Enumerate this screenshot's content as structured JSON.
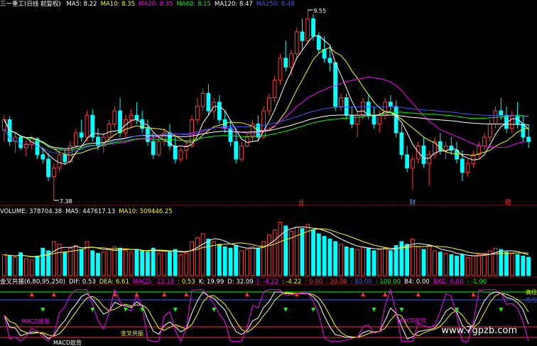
{
  "main_header": {
    "stock": "三一重工(日线 前复权)",
    "ma": [
      {
        "text": "MA5: 8.22",
        "color": "#ffffff"
      },
      {
        "text": "MA10: 8.35",
        "color": "#ffff00"
      },
      {
        "text": "MA20: 8.35",
        "color": "#ff00ff"
      },
      {
        "text": "MA60: 8.15",
        "color": "#00ff00"
      },
      {
        "text": "MA120: 8.47",
        "color": "#ffffff"
      },
      {
        "text": "MA250: 8.48",
        "color": "#3b5bff"
      }
    ]
  },
  "vol_header": {
    "items": [
      {
        "text": "VOLUME: 378704.38",
        "color": "#ffffff"
      },
      {
        "text": "MA5: 447617.13",
        "color": "#ffffff"
      },
      {
        "text": "MA10: 509446.25",
        "color": "#ffff00"
      }
    ]
  },
  "ind_header": {
    "items": [
      {
        "text": "金叉共振(6,80,95,250)",
        "color": "#ffffff"
      },
      {
        "text": "DIF: 0.53",
        "color": "#ffffff"
      },
      {
        "text": "DEA: 6.61",
        "color": "#ffff00"
      },
      {
        "text": "MACD: -12.18",
        "color": "#ff00ff"
      },
      {
        "text": ": 0.53",
        "color": "#ffff00"
      },
      {
        "text": "K: 19.99",
        "color": "#ffffff"
      },
      {
        "text": "D: 32.09",
        "color": "#ffffff"
      },
      {
        "text": "J: -4.22",
        "color": "#ff00ff"
      },
      {
        "text": ": -4.22",
        "color": "#ffff00"
      },
      {
        "text": ": 0.00",
        "color": "#ff3030"
      },
      {
        "text": ": 20.00",
        "color": "#ff3030"
      },
      {
        "text": ": 80.00",
        "color": "#3b5bff"
      },
      {
        "text": ": 100.00",
        "color": "#00ff00"
      },
      {
        "text": "B4: 0.00",
        "color": "#ffffff"
      },
      {
        "text": "BXG: 0.00",
        "color": "#ff00ff"
      },
      {
        "text": ": -1.00",
        "color": "#00ff00"
      }
    ]
  },
  "chart_data": [
    {
      "type": "candlestick",
      "name_label": "三一重工(日线 前复权)",
      "price_range": [
        7.38,
        9.55
      ],
      "high_label": "9.55",
      "low_label": "7.38",
      "events": [
        {
          "label": "业",
          "color": "#ff3030"
        },
        {
          "label": "财",
          "color": "#3b9bff"
        },
        {
          "label": "增",
          "color": "#ff3030"
        }
      ],
      "candles": [
        [
          8.18,
          8.35,
          8.05,
          8.3
        ],
        [
          8.3,
          8.34,
          8.0,
          8.05
        ],
        [
          8.05,
          8.15,
          7.92,
          8.1
        ],
        [
          8.1,
          8.12,
          7.95,
          7.98
        ],
        [
          7.98,
          8.06,
          7.88,
          8.02
        ],
        [
          8.02,
          8.12,
          7.96,
          8.08
        ],
        [
          8.08,
          8.1,
          7.85,
          7.9
        ],
        [
          7.9,
          7.98,
          7.8,
          7.85
        ],
        [
          7.85,
          7.92,
          7.6,
          7.65
        ],
        [
          7.65,
          7.8,
          7.38,
          7.75
        ],
        [
          7.75,
          7.95,
          7.7,
          7.9
        ],
        [
          7.9,
          7.96,
          7.78,
          7.82
        ],
        [
          7.82,
          8.05,
          7.8,
          8.0
        ],
        [
          8.0,
          8.2,
          7.98,
          8.15
        ],
        [
          8.15,
          8.3,
          8.05,
          8.1
        ],
        [
          8.1,
          8.4,
          8.05,
          8.35
        ],
        [
          8.35,
          8.42,
          8.05,
          8.1
        ],
        [
          8.1,
          8.2,
          7.95,
          8.0
        ],
        [
          8.0,
          8.15,
          7.92,
          8.1
        ],
        [
          8.1,
          8.3,
          8.05,
          8.25
        ],
        [
          8.25,
          8.45,
          8.2,
          8.4
        ],
        [
          8.4,
          8.55,
          8.1,
          8.15
        ],
        [
          8.15,
          8.35,
          8.1,
          8.3
        ],
        [
          8.3,
          8.42,
          8.2,
          8.35
        ],
        [
          8.35,
          8.5,
          8.25,
          8.3
        ],
        [
          8.3,
          8.4,
          8.15,
          8.2
        ],
        [
          8.2,
          8.3,
          8.0,
          8.05
        ],
        [
          8.05,
          8.15,
          7.85,
          7.9
        ],
        [
          7.9,
          8.1,
          7.88,
          8.05
        ],
        [
          8.05,
          8.2,
          8.0,
          8.15
        ],
        [
          8.15,
          8.25,
          7.95,
          8.0
        ],
        [
          8.0,
          8.1,
          7.8,
          7.85
        ],
        [
          7.85,
          7.98,
          7.82,
          7.95
        ],
        [
          7.95,
          8.05,
          7.85,
          8.0
        ],
        [
          8.0,
          8.35,
          7.98,
          8.3
        ],
        [
          8.3,
          8.55,
          8.25,
          8.45
        ],
        [
          8.45,
          8.65,
          8.4,
          8.6
        ],
        [
          8.6,
          8.7,
          8.35,
          8.4
        ],
        [
          8.4,
          8.55,
          8.3,
          8.5
        ],
        [
          8.5,
          8.58,
          8.25,
          8.3
        ],
        [
          8.3,
          8.4,
          8.15,
          8.2
        ],
        [
          8.2,
          8.3,
          8.0,
          8.05
        ],
        [
          8.05,
          8.2,
          7.8,
          7.85
        ],
        [
          7.85,
          8.05,
          7.82,
          8.0
        ],
        [
          8.0,
          8.15,
          7.98,
          8.1
        ],
        [
          8.1,
          8.3,
          8.05,
          8.25
        ],
        [
          8.25,
          8.35,
          8.05,
          8.1
        ],
        [
          8.1,
          8.45,
          8.08,
          8.4
        ],
        [
          8.4,
          8.6,
          8.35,
          8.55
        ],
        [
          8.55,
          8.8,
          8.5,
          8.75
        ],
        [
          8.75,
          9.05,
          8.7,
          9.0
        ],
        [
          9.0,
          9.2,
          8.85,
          8.9
        ],
        [
          8.9,
          9.1,
          8.8,
          9.05
        ],
        [
          9.05,
          9.35,
          9.0,
          9.3
        ],
        [
          9.3,
          9.45,
          9.1,
          9.2
        ],
        [
          9.2,
          9.55,
          9.15,
          9.45
        ],
        [
          9.45,
          9.5,
          9.2,
          9.25
        ],
        [
          9.25,
          9.3,
          9.05,
          9.1
        ],
        [
          9.1,
          9.25,
          8.95,
          9.0
        ],
        [
          9.0,
          9.15,
          8.85,
          8.95
        ],
        [
          8.95,
          8.6,
          8.4,
          8.45
        ],
        [
          8.45,
          8.6,
          8.4,
          8.55
        ],
        [
          8.55,
          8.6,
          8.3,
          8.35
        ],
        [
          8.35,
          8.45,
          8.2,
          8.25
        ],
        [
          8.25,
          8.4,
          8.1,
          8.35
        ],
        [
          8.35,
          8.55,
          8.3,
          8.5
        ],
        [
          8.5,
          8.58,
          8.3,
          8.35
        ],
        [
          8.35,
          8.45,
          8.2,
          8.25
        ],
        [
          8.25,
          8.4,
          8.15,
          8.35
        ],
        [
          8.35,
          8.55,
          8.3,
          8.5
        ],
        [
          8.5,
          8.58,
          8.4,
          8.45
        ],
        [
          8.45,
          8.52,
          8.1,
          8.15
        ],
        [
          8.15,
          8.25,
          7.85,
          7.9
        ],
        [
          7.9,
          8.0,
          7.7,
          7.75
        ],
        [
          7.75,
          7.9,
          7.5,
          7.85
        ],
        [
          7.85,
          8.05,
          7.8,
          8.0
        ],
        [
          8.0,
          8.1,
          7.75,
          7.8
        ],
        [
          7.8,
          7.95,
          7.55,
          7.9
        ],
        [
          7.9,
          8.1,
          7.85,
          8.05
        ],
        [
          8.05,
          8.15,
          7.9,
          7.95
        ],
        [
          7.95,
          8.05,
          7.85,
          8.0
        ],
        [
          8.0,
          8.1,
          7.9,
          7.95
        ],
        [
          7.95,
          8.05,
          7.8,
          7.85
        ],
        [
          7.85,
          7.95,
          7.6,
          7.7
        ],
        [
          7.7,
          7.85,
          7.65,
          7.8
        ],
        [
          7.8,
          7.95,
          7.75,
          7.9
        ],
        [
          7.9,
          8.05,
          7.85,
          8.0
        ],
        [
          8.0,
          8.15,
          7.95,
          8.1
        ],
        [
          8.1,
          8.3,
          8.05,
          8.25
        ],
        [
          8.25,
          8.45,
          8.2,
          8.4
        ],
        [
          8.4,
          8.55,
          8.3,
          8.35
        ],
        [
          8.35,
          8.45,
          8.15,
          8.2
        ],
        [
          8.2,
          8.4,
          8.15,
          8.35
        ],
        [
          8.35,
          8.5,
          8.2,
          8.25
        ],
        [
          8.25,
          8.35,
          8.05,
          8.1
        ],
        [
          8.1,
          8.25,
          7.98,
          8.05
        ]
      ],
      "ma_lines": [
        {
          "name": "MA5",
          "color": "#ffffff",
          "period": 5
        },
        {
          "name": "MA10",
          "color": "#ffff00",
          "period": 10
        },
        {
          "name": "MA20",
          "color": "#ff00ff",
          "period": 20
        },
        {
          "name": "MA60",
          "color": "#00ff00",
          "period": 60
        },
        {
          "name": "MA120",
          "color": "#ffffff",
          "period": 120
        },
        {
          "name": "MA250",
          "color": "#3b5bff",
          "period": 250
        }
      ]
    },
    {
      "type": "bar",
      "volume_max": 900000,
      "volumes": [
        320,
        300,
        280,
        350,
        260,
        240,
        300,
        420,
        380,
        520,
        480,
        360,
        420,
        460,
        400,
        520,
        380,
        340,
        360,
        400,
        440,
        420,
        380,
        360,
        400,
        380,
        360,
        420,
        340,
        380,
        360,
        400,
        320,
        340,
        520,
        580,
        640,
        560,
        520,
        480,
        440,
        420,
        460,
        380,
        400,
        440,
        420,
        520,
        620,
        700,
        820,
        760,
        680,
        740,
        720,
        780,
        700,
        640,
        600,
        560,
        520,
        480,
        440,
        420,
        400,
        440,
        420,
        380,
        400,
        420,
        380,
        460,
        520,
        480,
        560,
        440,
        400,
        460,
        380,
        360,
        340,
        320,
        300,
        320,
        280,
        300,
        320,
        340,
        380,
        420,
        400,
        360,
        340,
        320,
        300,
        280
      ],
      "ma_lines": [
        {
          "name": "MA5",
          "color": "#ffffff"
        },
        {
          "name": "MA10",
          "color": "#ffff00"
        }
      ]
    },
    {
      "type": "line",
      "labels": [
        "高位",
        "低位",
        "MACD底背",
        "MACD底背",
        "金叉共振",
        "MACD底背"
      ],
      "label_colors": [
        "#ffff00",
        "#3b5bff",
        "#ff00ff",
        "#ff00ff",
        "#ffff00",
        "#ffffff"
      ]
    }
  ],
  "watermark": "www.7gpzb.com"
}
